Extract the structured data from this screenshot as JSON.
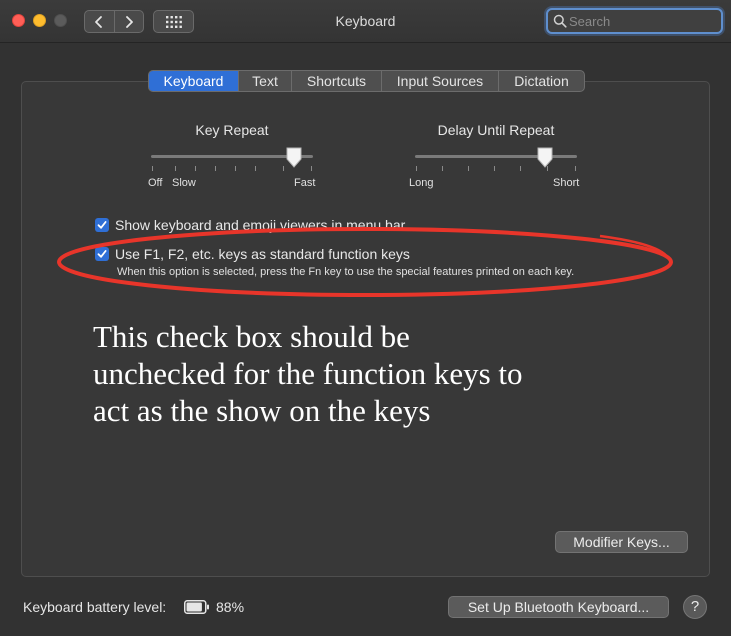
{
  "window": {
    "title": "Keyboard"
  },
  "search": {
    "placeholder": "Search",
    "value": ""
  },
  "tabs": [
    {
      "label": "Keyboard",
      "active": true
    },
    {
      "label": "Text",
      "active": false
    },
    {
      "label": "Shortcuts",
      "active": false
    },
    {
      "label": "Input Sources",
      "active": false
    },
    {
      "label": "Dictation",
      "active": false
    }
  ],
  "key_repeat": {
    "title": "Key Repeat",
    "left_label_1": "Off",
    "left_label_2": "Slow",
    "right_label": "Fast",
    "value": 0.88
  },
  "delay_until_repeat": {
    "title": "Delay Until Repeat",
    "left_label": "Long",
    "right_label": "Short",
    "value": 0.8
  },
  "options": {
    "show_viewers": {
      "label": "Show keyboard and emoji viewers in menu bar",
      "checked": true
    },
    "fn_keys": {
      "label": "Use F1, F2, etc. keys as standard function keys",
      "checked": true,
      "description": "When this option is selected, press the Fn key to use the special features printed on each key."
    }
  },
  "annotation": {
    "lines": [
      "This check box should be",
      "unchecked for the function keys to",
      "act as the show on the keys"
    ],
    "color": "#e8352a"
  },
  "buttons": {
    "modifier_keys": "Modifier Keys...",
    "bluetooth": "Set Up Bluetooth Keyboard...",
    "help": "?"
  },
  "battery": {
    "label": "Keyboard battery level:",
    "percent": "88%",
    "level": 0.88
  },
  "colors": {
    "accent": "#2f6fd6",
    "background": "#323232"
  },
  "icons": [
    "chevron-left-icon",
    "chevron-right-icon",
    "grid-icon",
    "search-icon",
    "checkmark-icon",
    "battery-icon"
  ]
}
